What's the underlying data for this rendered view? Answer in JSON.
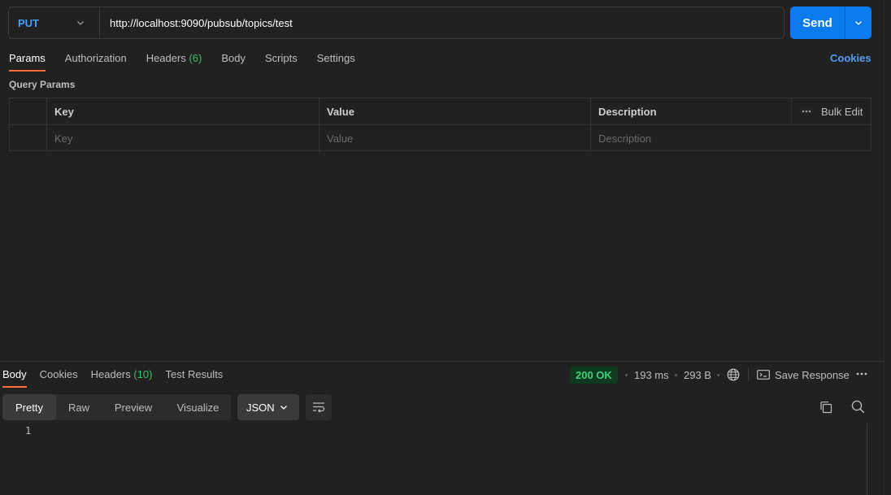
{
  "request": {
    "method": "PUT",
    "url": "http://localhost:9090/pubsub/topics/test",
    "send_label": "Send"
  },
  "request_tabs": [
    {
      "label": "Params",
      "count": "",
      "active": true
    },
    {
      "label": "Authorization",
      "count": ""
    },
    {
      "label": "Headers",
      "count": "(6)"
    },
    {
      "label": "Body",
      "count": ""
    },
    {
      "label": "Scripts",
      "count": ""
    },
    {
      "label": "Settings",
      "count": ""
    }
  ],
  "cookies_link": "Cookies",
  "query_params": {
    "title": "Query Params",
    "columns": [
      "Key",
      "Value",
      "Description"
    ],
    "bulk_edit": "Bulk Edit",
    "placeholders": {
      "key": "Key",
      "value": "Value",
      "description": "Description"
    }
  },
  "response": {
    "tabs": [
      {
        "label": "Body",
        "count": "",
        "active": true
      },
      {
        "label": "Cookies",
        "count": ""
      },
      {
        "label": "Headers",
        "count": "(10)"
      },
      {
        "label": "Test Results",
        "count": ""
      }
    ],
    "status": "200 OK",
    "time": "193 ms",
    "size": "293 B",
    "save_response": "Save Response",
    "views": [
      "Pretty",
      "Raw",
      "Preview",
      "Visualize"
    ],
    "active_view": "Pretty",
    "format": "JSON",
    "line_numbers": [
      "1"
    ]
  },
  "colors": {
    "accent_orange": "#ff6c37",
    "method_blue": "#4d9df8",
    "send_blue": "#097bed",
    "success_green": "#3fd17a"
  },
  "icons": [
    "chevron-down-icon",
    "more-horizontal-icon",
    "globe-icon",
    "save-icon",
    "wrap-lines-icon",
    "copy-icon",
    "search-icon"
  ]
}
